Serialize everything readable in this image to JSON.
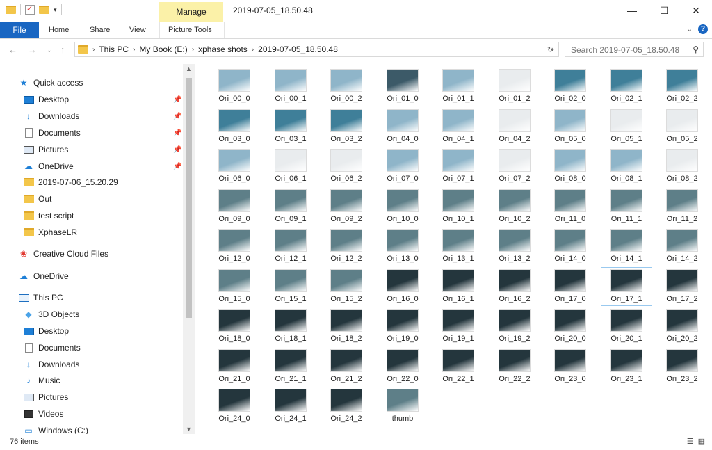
{
  "window": {
    "title": "2019-07-05_18.50.48",
    "contextual_tab": "Manage",
    "controls": [
      "—",
      "☐",
      "✕"
    ]
  },
  "ribbon": {
    "tabs": [
      "File",
      "Home",
      "Share",
      "View",
      "Picture Tools"
    ],
    "file_color": "#1966c2",
    "manage_color": "#fbf1a8"
  },
  "address": {
    "breadcrumbs": [
      "This PC",
      "My Book (E:)",
      "xphase shots",
      "2019-07-05_18.50.48"
    ],
    "search_placeholder": "Search 2019-07-05_18.50.48"
  },
  "sidebar": {
    "quick_access": {
      "label": "Quick access",
      "icon": "star-icon"
    },
    "quick_items": [
      {
        "label": "Desktop",
        "icon": "desktop-icon",
        "pinned": true
      },
      {
        "label": "Downloads",
        "icon": "download-arrow-icon",
        "pinned": true
      },
      {
        "label": "Documents",
        "icon": "document-icon",
        "pinned": true
      },
      {
        "label": "Pictures",
        "icon": "pictures-icon",
        "pinned": true
      },
      {
        "label": "OneDrive",
        "icon": "cloud-icon",
        "pinned": true
      },
      {
        "label": "2019-07-06_15.20.29",
        "icon": "folder-icon",
        "pinned": false
      },
      {
        "label": "Out",
        "icon": "folder-icon",
        "pinned": false
      },
      {
        "label": "test script",
        "icon": "folder-icon",
        "pinned": false
      },
      {
        "label": "XphaseLR",
        "icon": "folder-icon",
        "pinned": false
      }
    ],
    "creative_cloud": "Creative Cloud Files",
    "onedrive": "OneDrive",
    "this_pc": "This PC",
    "pc_items": [
      {
        "label": "3D Objects",
        "icon": "cube-icon"
      },
      {
        "label": "Desktop",
        "icon": "desktop-icon"
      },
      {
        "label": "Documents",
        "icon": "document-icon"
      },
      {
        "label": "Downloads",
        "icon": "download-arrow-icon"
      },
      {
        "label": "Music",
        "icon": "music-note-icon"
      },
      {
        "label": "Pictures",
        "icon": "pictures-icon"
      },
      {
        "label": "Videos",
        "icon": "video-icon"
      },
      {
        "label": "Windows (C:)",
        "icon": "drive-icon"
      }
    ]
  },
  "files": [
    {
      "name": "Ori_00_0",
      "tone": "sky"
    },
    {
      "name": "Ori_00_1",
      "tone": "sky"
    },
    {
      "name": "Ori_00_2",
      "tone": "sky"
    },
    {
      "name": "Ori_01_0",
      "tone": "dark"
    },
    {
      "name": "Ori_01_1",
      "tone": "sky"
    },
    {
      "name": "Ori_01_2",
      "tone": "white"
    },
    {
      "name": "Ori_02_0",
      "tone": "teal"
    },
    {
      "name": "Ori_02_1",
      "tone": "teal"
    },
    {
      "name": "Ori_02_2",
      "tone": "teal"
    },
    {
      "name": "Ori_03_0",
      "tone": "teal"
    },
    {
      "name": "Ori_03_1",
      "tone": "teal"
    },
    {
      "name": "Ori_03_2",
      "tone": "teal"
    },
    {
      "name": "Ori_04_0",
      "tone": "sky"
    },
    {
      "name": "Ori_04_1",
      "tone": "sky"
    },
    {
      "name": "Ori_04_2",
      "tone": "white"
    },
    {
      "name": "Ori_05_0",
      "tone": "sky"
    },
    {
      "name": "Ori_05_1",
      "tone": "white"
    },
    {
      "name": "Ori_05_2",
      "tone": "white"
    },
    {
      "name": "Ori_06_0",
      "tone": "sky"
    },
    {
      "name": "Ori_06_1",
      "tone": "white"
    },
    {
      "name": "Ori_06_2",
      "tone": "white"
    },
    {
      "name": "Ori_07_0",
      "tone": "sky"
    },
    {
      "name": "Ori_07_1",
      "tone": "sky"
    },
    {
      "name": "Ori_07_2",
      "tone": "white"
    },
    {
      "name": "Ori_08_0",
      "tone": "sky"
    },
    {
      "name": "Ori_08_1",
      "tone": "sky"
    },
    {
      "name": "Ori_08_2",
      "tone": "white"
    },
    {
      "name": "Ori_09_0",
      "tone": "scene"
    },
    {
      "name": "Ori_09_1",
      "tone": "scene"
    },
    {
      "name": "Ori_09_2",
      "tone": "scene"
    },
    {
      "name": "Ori_10_0",
      "tone": "scene"
    },
    {
      "name": "Ori_10_1",
      "tone": "scene"
    },
    {
      "name": "Ori_10_2",
      "tone": "scene"
    },
    {
      "name": "Ori_11_0",
      "tone": "scene"
    },
    {
      "name": "Ori_11_1",
      "tone": "scene"
    },
    {
      "name": "Ori_11_2",
      "tone": "scene"
    },
    {
      "name": "Ori_12_0",
      "tone": "scene"
    },
    {
      "name": "Ori_12_1",
      "tone": "scene"
    },
    {
      "name": "Ori_12_2",
      "tone": "scene"
    },
    {
      "name": "Ori_13_0",
      "tone": "scene"
    },
    {
      "name": "Ori_13_1",
      "tone": "scene"
    },
    {
      "name": "Ori_13_2",
      "tone": "scene"
    },
    {
      "name": "Ori_14_0",
      "tone": "scene"
    },
    {
      "name": "Ori_14_1",
      "tone": "scene"
    },
    {
      "name": "Ori_14_2",
      "tone": "scene"
    },
    {
      "name": "Ori_15_0",
      "tone": "scene"
    },
    {
      "name": "Ori_15_1",
      "tone": "scene"
    },
    {
      "name": "Ori_15_2",
      "tone": "scene"
    },
    {
      "name": "Ori_16_0",
      "tone": "night"
    },
    {
      "name": "Ori_16_1",
      "tone": "night"
    },
    {
      "name": "Ori_16_2",
      "tone": "night"
    },
    {
      "name": "Ori_17_0",
      "tone": "night"
    },
    {
      "name": "Ori_17_1",
      "tone": "night"
    },
    {
      "name": "Ori_17_2",
      "tone": "night"
    },
    {
      "name": "Ori_18_0",
      "tone": "night"
    },
    {
      "name": "Ori_18_1",
      "tone": "night"
    },
    {
      "name": "Ori_18_2",
      "tone": "night"
    },
    {
      "name": "Ori_19_0",
      "tone": "night"
    },
    {
      "name": "Ori_19_1",
      "tone": "night"
    },
    {
      "name": "Ori_19_2",
      "tone": "night"
    },
    {
      "name": "Ori_20_0",
      "tone": "night"
    },
    {
      "name": "Ori_20_1",
      "tone": "night"
    },
    {
      "name": "Ori_20_2",
      "tone": "night"
    },
    {
      "name": "Ori_21_0",
      "tone": "night"
    },
    {
      "name": "Ori_21_1",
      "tone": "night"
    },
    {
      "name": "Ori_21_2",
      "tone": "night"
    },
    {
      "name": "Ori_22_0",
      "tone": "night"
    },
    {
      "name": "Ori_22_1",
      "tone": "night"
    },
    {
      "name": "Ori_22_2",
      "tone": "night"
    },
    {
      "name": "Ori_23_0",
      "tone": "night"
    },
    {
      "name": "Ori_23_1",
      "tone": "night"
    },
    {
      "name": "Ori_23_2",
      "tone": "night"
    },
    {
      "name": "Ori_24_0",
      "tone": "night"
    },
    {
      "name": "Ori_24_1",
      "tone": "night"
    },
    {
      "name": "Ori_24_2",
      "tone": "night"
    },
    {
      "name": "thumb",
      "tone": "scene"
    }
  ],
  "selected_file": "Ori_17_1",
  "tone_colors": {
    "sky": "#8fb5c9",
    "teal": "#3f7f99",
    "white": "#e9ecee",
    "dark": "#3c5a68",
    "scene": "#5e7f88",
    "night": "#24363d"
  },
  "status": {
    "item_count": "76 items"
  }
}
